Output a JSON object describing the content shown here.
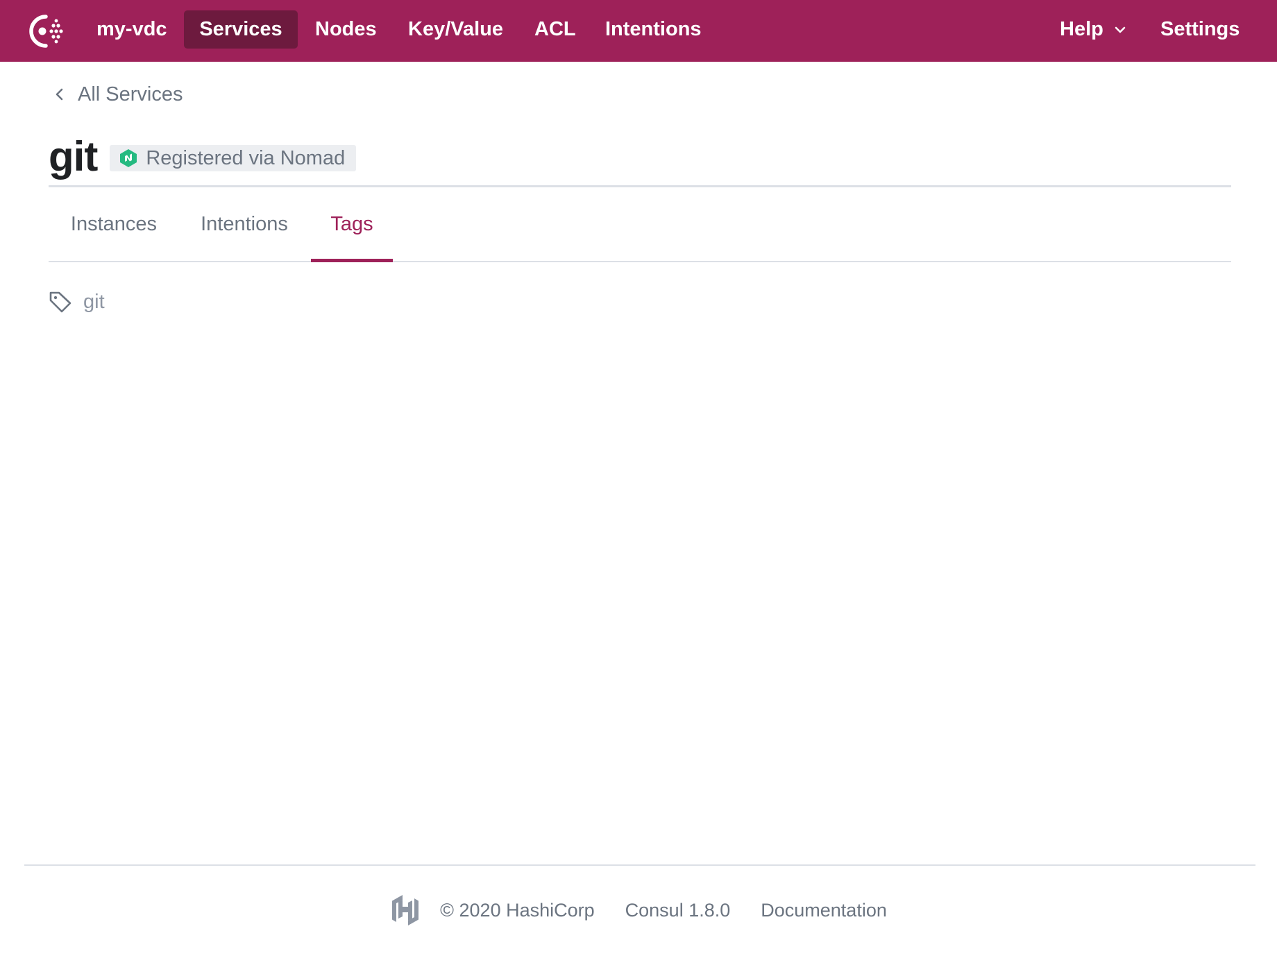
{
  "header": {
    "logo_icon": "consul-logo-icon",
    "datacenter": "my-vdc",
    "nav": {
      "services": "Services",
      "nodes": "Nodes",
      "kv": "Key/Value",
      "acl": "ACL",
      "intentions": "Intentions"
    },
    "help": "Help",
    "help_icon": "chevron-down-icon",
    "settings": "Settings",
    "active": "Services"
  },
  "breadcrumb": {
    "icon": "chevron-left-icon",
    "label": "All Services"
  },
  "service": {
    "name": "git",
    "badge": {
      "icon": "nomad-icon",
      "label": "Registered via Nomad"
    }
  },
  "tabs": {
    "instances": "Instances",
    "intentions": "Intentions",
    "tags": "Tags",
    "active": "Tags"
  },
  "tags": [
    {
      "icon": "tag-icon",
      "label": "git"
    }
  ],
  "footer": {
    "logo_icon": "hashicorp-logo-icon",
    "copyright": "© 2020 HashiCorp",
    "version": "Consul 1.8.0",
    "docs": "Documentation"
  },
  "colors": {
    "brand": "#9e2159",
    "brand_dark": "#6d1a3e",
    "text_muted": "#6b7480",
    "nomad_green": "#25ba81"
  }
}
